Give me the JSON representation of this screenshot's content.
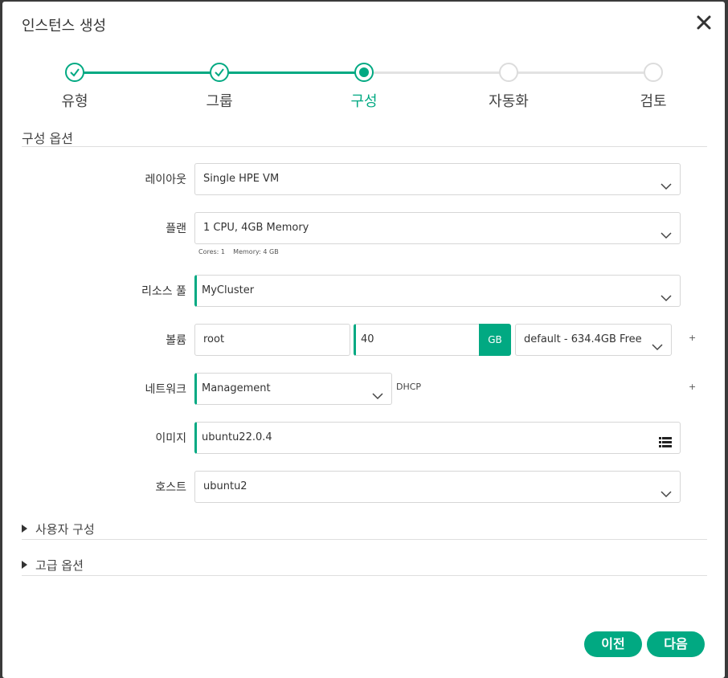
{
  "modal": {
    "title": "인스턴스 생성"
  },
  "steps": [
    {
      "label": "유형",
      "state": "done"
    },
    {
      "label": "그룹",
      "state": "done"
    },
    {
      "label": "구성",
      "state": "current"
    },
    {
      "label": "자동화",
      "state": "todo"
    },
    {
      "label": "검토",
      "state": "todo"
    }
  ],
  "section": {
    "title": "구성 옵션"
  },
  "form": {
    "layout": {
      "label": "레이아웃",
      "value": "Single HPE VM"
    },
    "plan": {
      "label": "플랜",
      "value": "1 CPU, 4GB Memory",
      "hint": "Cores: 1    Memory: 4 GB"
    },
    "resource_pool": {
      "label": "리소스 풀",
      "value": "MyCluster"
    },
    "volume": {
      "label": "볼륨",
      "name": "root",
      "size": "40",
      "unit": "GB",
      "datastore": "default - 634.4GB Free",
      "add": "+"
    },
    "network": {
      "label": "네트워크",
      "value": "Management",
      "ip_mode": "DHCP",
      "add": "+"
    },
    "image": {
      "label": "이미지",
      "value": "ubuntu22.0.4"
    },
    "host": {
      "label": "호스트",
      "value": "ubuntu2"
    }
  },
  "collapsibles": {
    "user_config": "사용자 구성",
    "advanced": "고급 옵션"
  },
  "buttons": {
    "prev": "이전",
    "next": "다음"
  },
  "colors": {
    "accent": "#01a982"
  }
}
